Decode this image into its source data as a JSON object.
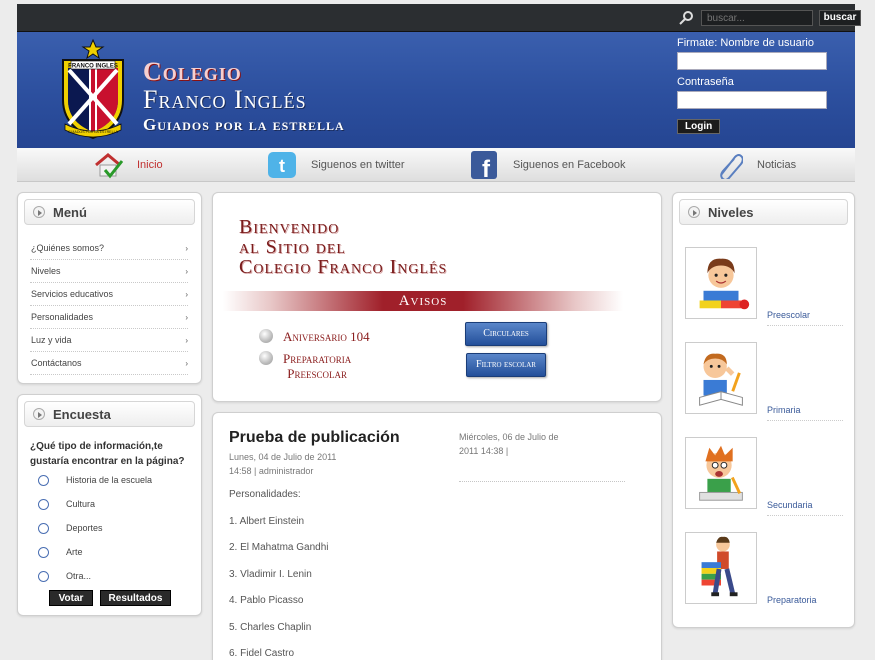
{
  "topbar": {
    "search_placeholder": "buscar...",
    "search_button": "buscar"
  },
  "header": {
    "brand_line1": "Colegio",
    "brand_line2": "Franco Inglés",
    "brand_line3": "Guiados por la estrella",
    "crest_text": "FRANCO INGLES",
    "crest_motto": "GUIADOS POR LA ESTRELLA",
    "login_user_label": "Firmate: Nombre de usuario",
    "login_pass_label": "Contraseña",
    "login_button": "Login"
  },
  "nav": {
    "items": [
      {
        "label": "Inicio",
        "icon": "home-check-icon"
      },
      {
        "label": "Siguenos en twitter",
        "icon": "twitter-icon"
      },
      {
        "label": "Siguenos en Facebook",
        "icon": "facebook-icon"
      },
      {
        "label": "Noticias",
        "icon": "paperclip-icon"
      }
    ]
  },
  "menu": {
    "title": "Menú",
    "items": [
      "¿Quiénes somos?",
      "Niveles",
      "Servicios educativos",
      "Personalidades",
      "Luz y vida",
      "Contáctanos"
    ],
    "arrow": "›"
  },
  "poll": {
    "title": "Encuesta",
    "question": "¿Qué tipo de información,te gustaría encontrar en la página?",
    "options": [
      "Historia de la escuela",
      "Cultura",
      "Deportes",
      "Arte",
      "Otra..."
    ],
    "vote_button": "Votar",
    "results_button": "Resultados"
  },
  "welcome": {
    "line1": "Bienvenido",
    "line2": "al Sitio del",
    "line3": "Colegio Franco Inglés",
    "avisos": "Avisos",
    "aviso1": "Aniversario 104",
    "aviso2a": "Preparatoria",
    "aviso2b": "Preescolar",
    "btn_circulares": "Circulares",
    "btn_filtro": "Filtro escolar"
  },
  "article": {
    "title": "Prueba de publicación",
    "date": "Lunes, 04 de Julio de 2011",
    "time_author": "14:58  |  administrador",
    "side_date": "Miércoles, 06 de Julio de",
    "side_time": "2011 14:38  |",
    "intro": "Personalidades:",
    "list": [
      "1. Albert Einstein",
      "2. El Mahatma Gandhi",
      "3. Vladimir I. Lenin",
      "4. Pablo Picasso",
      "5. Charles Chaplin",
      "6. Fidel Castro"
    ]
  },
  "niveles": {
    "title": "Niveles",
    "items": [
      "Preescolar",
      "Primaria",
      "Secundaria",
      "Preparatoria"
    ]
  },
  "colors": {
    "header_blue": "#2c4f9e",
    "accent_red": "#a0202a",
    "link_blue": "#3b5b9a"
  }
}
